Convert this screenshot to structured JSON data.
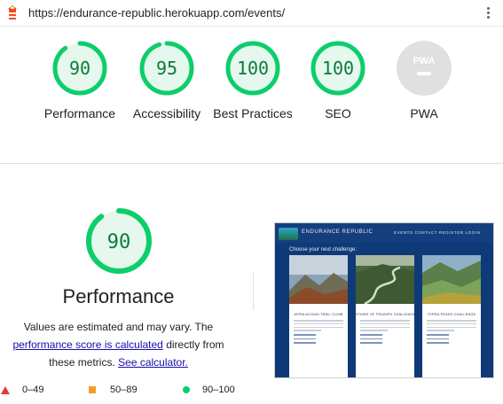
{
  "browser": {
    "url": "https://endurance-republic.herokuapp.com/events/",
    "menu_icon": "kebab-menu-icon"
  },
  "colors": {
    "pass": "#0cce6b",
    "pass_text": "#0b7a3b",
    "average": "#f59b2a",
    "fail": "#e53935",
    "na": "#e0e0e0"
  },
  "gauges": [
    {
      "key": "performance",
      "label": "Performance",
      "score": 90
    },
    {
      "key": "accessibility",
      "label": "Accessibility",
      "score": 95
    },
    {
      "key": "best-practices",
      "label": "Best Practices",
      "score": 100
    },
    {
      "key": "seo",
      "label": "SEO",
      "score": 100
    },
    {
      "key": "pwa",
      "label": "PWA",
      "score": null,
      "badge": "PWA"
    }
  ],
  "performance_detail": {
    "score": 90,
    "title": "Performance",
    "desc_prefix": "Values are estimated and may vary. The",
    "link_score": "performance score is calculated",
    "desc_middle": "directly from these metrics.",
    "link_calc": "See calculator."
  },
  "legend": [
    {
      "shape": "triangle",
      "range": "0–49"
    },
    {
      "shape": "square",
      "range": "50–89"
    },
    {
      "shape": "circle",
      "range": "90–100"
    }
  ],
  "screenshot": {
    "brand": "ENDURANCE REPUBLIC",
    "nav_links": "EVENTS  CONTACT  REGISTER  LOGIN",
    "heading": "Choose your next challenge:",
    "cards": [
      {
        "title": "APPALACHIAN TRAIL CLIMB"
      },
      {
        "title": "STAIRS OF TRIUMPH CHALLENGE"
      },
      {
        "title": "TERRA PEAKS CHALLENGE"
      }
    ]
  }
}
